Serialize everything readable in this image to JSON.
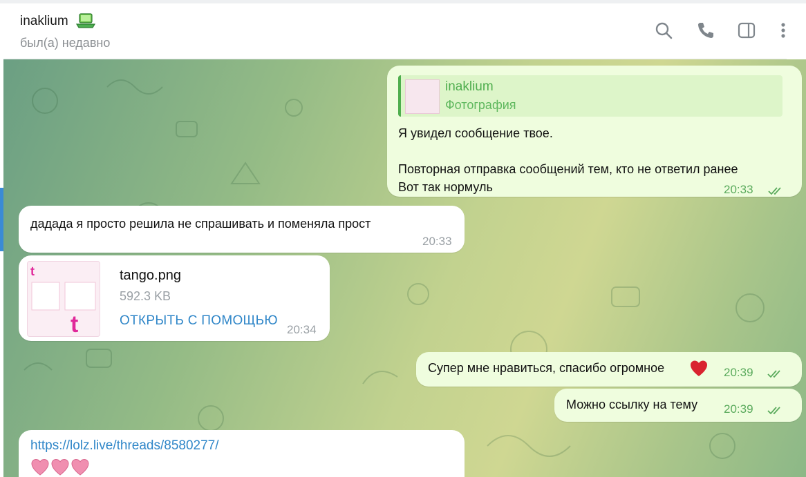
{
  "header": {
    "contact_name": "inaklium",
    "status": "был(а) недавно",
    "icons": [
      "search-icon",
      "phone-icon",
      "sidebar-toggle-icon",
      "more-vertical-icon"
    ]
  },
  "messages": {
    "m1": {
      "reply_author": "inaklium",
      "reply_type": "Фотография",
      "line1": "Я увидел сообщение твое.",
      "line2": "Повторная отправка сообщений тем, кто не ответил ранее",
      "line3": "Вот так нормуль",
      "time": "20:33"
    },
    "m2": {
      "text": "дадада я просто решила не спрашивать и поменяла прост",
      "time": "20:33"
    },
    "m3": {
      "file_name": "tango.png",
      "file_size": "592.3 KB",
      "open_label": "ОТКРЫТЬ С ПОМОЩЬЮ",
      "time": "20:34"
    },
    "m4": {
      "text": "Супер мне нравиться, спасибо огромное",
      "time": "20:39"
    },
    "m5": {
      "text": "Можно ссылку на тему",
      "time": "20:39"
    },
    "m6": {
      "link": "https://lolz.live/threads/8580277/"
    }
  },
  "colors": {
    "outgoing_bubble": "#effdde",
    "incoming_bubble": "#ffffff",
    "accent_green": "#4fae4e",
    "link_blue": "#2f86c8"
  }
}
